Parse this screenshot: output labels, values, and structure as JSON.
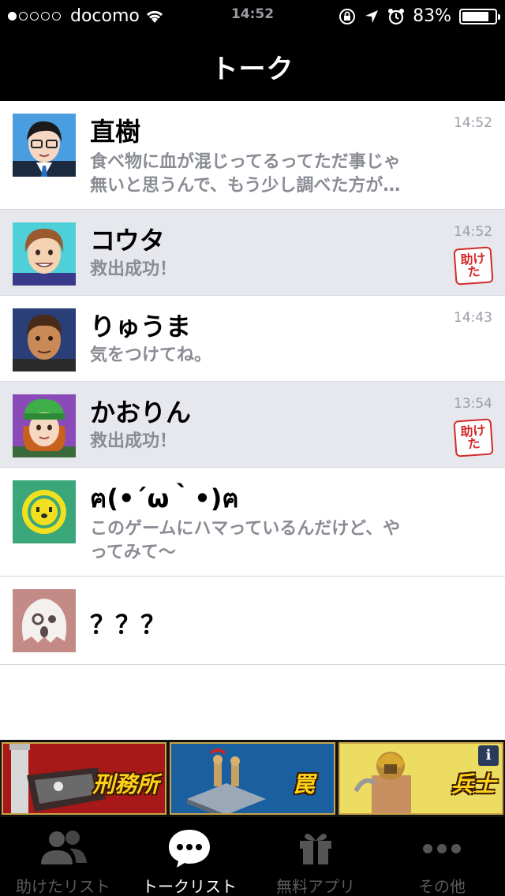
{
  "status_bar": {
    "signal_dots_filled": 1,
    "signal_dots_total": 5,
    "carrier": "docomo",
    "time": "14:52",
    "battery": "83%",
    "battery_level": 0.83
  },
  "nav": {
    "title": "トーク"
  },
  "chats": [
    {
      "name": "直樹",
      "message_line1": "食べ物に血が混じってるってただ事じゃ",
      "message_line2": "無いと思うんで、もう少し調べた方が…",
      "time": "14:52",
      "unread": false,
      "stamp": "",
      "avatar_icon": "naoki-avatar"
    },
    {
      "name": "コウタ",
      "message_line1": "救出成功！",
      "message_line2": "",
      "time": "14:52",
      "unread": true,
      "stamp": "助けた",
      "avatar_icon": "kouta-avatar"
    },
    {
      "name": "りゅうま",
      "message_line1": "気をつけてね。",
      "message_line2": "",
      "time": "14:43",
      "unread": false,
      "stamp": "",
      "avatar_icon": "ryuuma-avatar"
    },
    {
      "name": "かおりん",
      "message_line1": "救出成功！",
      "message_line2": "",
      "time": "13:54",
      "unread": true,
      "stamp": "助けた",
      "avatar_icon": "kaorin-avatar"
    },
    {
      "name": "ฅ(•´ω｀•)ฅ",
      "message_line1": "このゲームにハマっているんだけど、や",
      "message_line2": "ってみて〜",
      "time": "",
      "unread": false,
      "stamp": "",
      "avatar_icon": "bear-face-avatar"
    },
    {
      "name": "？？？",
      "message_line1": "",
      "message_line2": "",
      "time": "",
      "unread": false,
      "stamp": "",
      "avatar_icon": "ghost-avatar"
    }
  ],
  "ads": [
    {
      "label": "刑務所",
      "icon": "prison-tower"
    },
    {
      "label": "罠",
      "icon": "trap-soldiers"
    },
    {
      "label": "兵士",
      "icon": "gladiator"
    }
  ],
  "ad_info": "i",
  "tabs": [
    {
      "label": "助けたリスト",
      "icon": "people-icon",
      "active": false
    },
    {
      "label": "トークリスト",
      "icon": "chat-bubble-icon",
      "active": true
    },
    {
      "label": "無料アプリ",
      "icon": "gift-icon",
      "active": false
    },
    {
      "label": "その他",
      "icon": "more-dots-icon",
      "active": false
    }
  ],
  "colors": {
    "unread_row": "#e6e8ee",
    "stamp_red": "#d42a2a",
    "ad_label": "#ffd21a"
  }
}
